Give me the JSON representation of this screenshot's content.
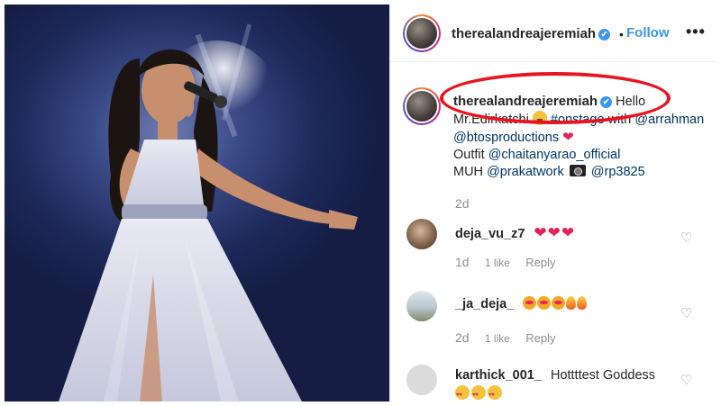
{
  "post": {
    "username": "therealandreajeremiah",
    "verified_mark": "✔",
    "dot": "•",
    "follow_label": "Follow",
    "more_label": "•••"
  },
  "caption": {
    "username": "therealandreajeremiah",
    "text_1": "Hello Mr.Edirkatchi",
    "hashtag": "#onstage",
    "text_2": "with",
    "mention_1": "@arrahman",
    "mention_2": "@btosproductions",
    "heart": "❤",
    "text_3": "Outfit",
    "mention_3": "@chaitanyarao_official",
    "text_4": "MUH",
    "mention_4": "@prakatwork",
    "mention_5": "@rp3825",
    "time": "2d"
  },
  "comments": [
    {
      "username": "deja_vu_z7",
      "text": "",
      "hearts": "❤❤❤",
      "age": "1d",
      "likes": "1 like",
      "reply": "Reply"
    },
    {
      "username": "_ja_deja_",
      "text": "",
      "age": "2d",
      "likes": "1 like",
      "reply": "Reply"
    },
    {
      "username": "karthick_001_",
      "text": "Hottttest Goddess"
    }
  ],
  "icons": {
    "like": "heart-outline-icon",
    "like_glyph": "♡"
  },
  "colors": {
    "accent": "#3897f0",
    "highlight": "#e8141f",
    "meta": "#8e8e8e"
  }
}
